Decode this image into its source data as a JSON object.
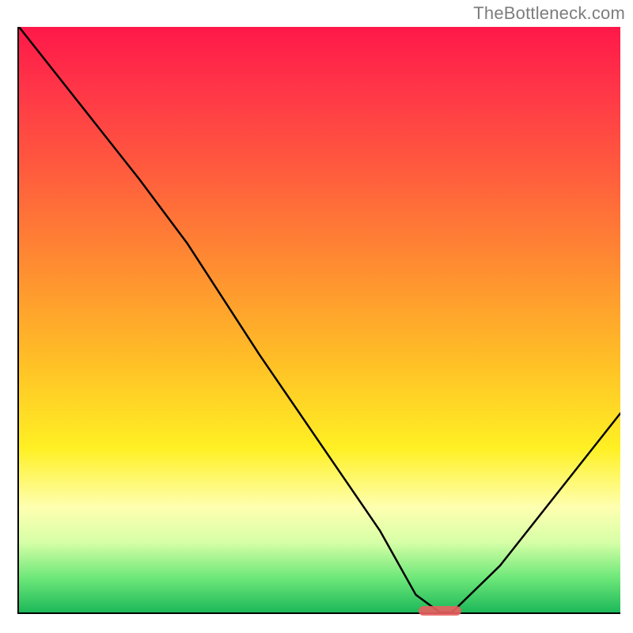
{
  "watermark": "TheBottleneck.com",
  "chart_data": {
    "type": "line",
    "title": "",
    "xlabel": "",
    "ylabel": "",
    "xlim": [
      0,
      100
    ],
    "ylim": [
      0,
      100
    ],
    "grid": false,
    "legend": false,
    "background": "red-to-green vertical gradient",
    "curve_description": "bottleneck % curve: high on the left, descending to a minimum near the right third, rising again toward the right edge",
    "x": [
      0,
      10,
      20,
      28,
      40,
      50,
      60,
      66,
      70,
      72,
      80,
      90,
      100
    ],
    "values": [
      100,
      87,
      74,
      63,
      44,
      29,
      14,
      3,
      0,
      0,
      8,
      21,
      34
    ],
    "optimal_marker": {
      "x_start": 67,
      "x_end": 73,
      "y": 0
    }
  },
  "colors": {
    "axis": "#000000",
    "curve": "#000000",
    "marker": "#e96060",
    "watermark": "#7d7d7d"
  }
}
